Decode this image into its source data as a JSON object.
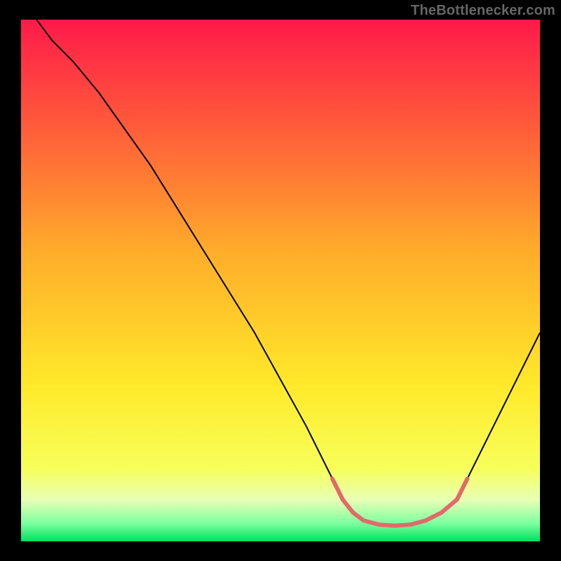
{
  "watermark": "TheBottlenecker.com",
  "chart_data": {
    "type": "line",
    "title": "",
    "xlabel": "",
    "ylabel": "",
    "xlim": [
      0,
      100
    ],
    "ylim": [
      0,
      100
    ],
    "background_gradient": {
      "stops": [
        {
          "offset": 0.0,
          "color": "#ff1a4a"
        },
        {
          "offset": 0.2,
          "color": "#ff5a3a"
        },
        {
          "offset": 0.45,
          "color": "#ffae2a"
        },
        {
          "offset": 0.7,
          "color": "#ffe92a"
        },
        {
          "offset": 0.86,
          "color": "#f7ff5a"
        },
        {
          "offset": 0.92,
          "color": "#e8ffb4"
        },
        {
          "offset": 0.965,
          "color": "#7effa0"
        },
        {
          "offset": 1.0,
          "color": "#00e060"
        }
      ]
    },
    "series": [
      {
        "name": "bottleneck-curve-left",
        "color": "#000000",
        "width": 2,
        "x": [
          3,
          6,
          10,
          15,
          20,
          25,
          30,
          35,
          40,
          45,
          50,
          55,
          58,
          60
        ],
        "y": [
          100,
          96,
          92,
          86,
          79,
          72,
          64,
          56,
          48,
          40,
          31,
          22,
          16,
          12
        ]
      },
      {
        "name": "bottleneck-curve-right",
        "color": "#000000",
        "width": 2,
        "x": [
          86,
          90,
          94,
          97,
          100
        ],
        "y": [
          12,
          20,
          28,
          34,
          40
        ]
      },
      {
        "name": "optimal-band",
        "color": "#e16a6a",
        "width": 6,
        "linecap": "round",
        "x": [
          60,
          62,
          64,
          66,
          69,
          72,
          75,
          78,
          81,
          84,
          86
        ],
        "y": [
          12,
          8,
          5.5,
          4.0,
          3.2,
          3.0,
          3.2,
          4.0,
          5.5,
          8,
          12
        ]
      }
    ]
  }
}
